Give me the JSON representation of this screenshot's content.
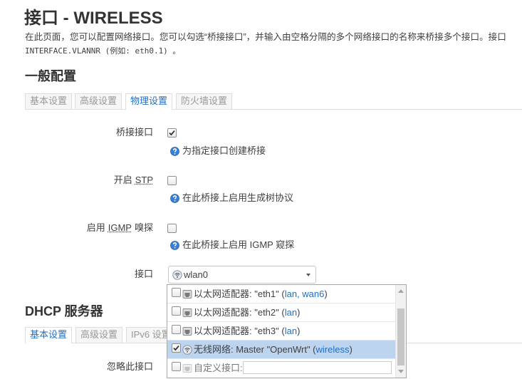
{
  "page": {
    "title": "接口 - WIRELESS",
    "description": "在此页面，您可以配置网络接口。您可以勾选“桥接接口”，并输入由空格分隔的多个网络接口的名称来桥接多个接口。接口",
    "description_code": "INTERFACE.VLANNR (例如: eth0.1) 。"
  },
  "general": {
    "heading": "一般配置",
    "tabs": [
      {
        "label": "基本设置",
        "active": false
      },
      {
        "label": "高级设置",
        "active": false
      },
      {
        "label": "物理设置",
        "active": true
      },
      {
        "label": "防火墙设置",
        "active": false
      }
    ]
  },
  "fields": {
    "bridge": {
      "label": "桥接接口",
      "checked": true,
      "help": "为指定接口创建桥接",
      "help_icon": "help-icon"
    },
    "stp": {
      "label": "开启",
      "abbr": "STP",
      "checked": false,
      "help": "在此桥接上启用生成树协议",
      "help_icon": "help-icon"
    },
    "igmp": {
      "label": "启用",
      "abbr": "IGMP",
      "label_suffix": "嗅探",
      "checked": false,
      "help": "在此桥接上启用 IGMP 窥探",
      "help_icon": "help-icon"
    },
    "interface": {
      "label": "接口",
      "selected": "wlan0",
      "selected_icon": "wireless-icon"
    }
  },
  "interface_dropdown": {
    "items": [
      {
        "icon": "ethernet-icon",
        "checked": false,
        "highlighted": false,
        "label": "以太网适配器: \"eth1\" (",
        "zone": "lan, wan6",
        "suffix": ")"
      },
      {
        "icon": "ethernet-icon",
        "checked": false,
        "highlighted": false,
        "label": "以太网适配器: \"eth2\" (",
        "zone": "lan",
        "suffix": ")"
      },
      {
        "icon": "ethernet-icon",
        "checked": false,
        "highlighted": false,
        "label": "以太网适配器: \"eth3\" (",
        "zone": "lan",
        "suffix": ")"
      },
      {
        "icon": "wireless-icon",
        "checked": true,
        "highlighted": true,
        "label": "无线网络: Master \"OpenWrt\" (",
        "zone": "wireless",
        "suffix": ")"
      },
      {
        "icon": "custom-interface-icon",
        "checked": false,
        "highlighted": false,
        "label": "自定义接口:",
        "input_value": ""
      }
    ]
  },
  "dhcp": {
    "heading": "DHCP 服务器",
    "tabs": [
      {
        "label": "基本设置",
        "active": true
      },
      {
        "label": "高级设置",
        "active": false
      },
      {
        "label": "IPv6 设置",
        "active": false
      }
    ],
    "ignore_label": "忽略此接口"
  },
  "colors": {
    "link": "#1f6fc5",
    "highlight": "#bcd4ee",
    "help_icon": "#3a7fd0"
  }
}
